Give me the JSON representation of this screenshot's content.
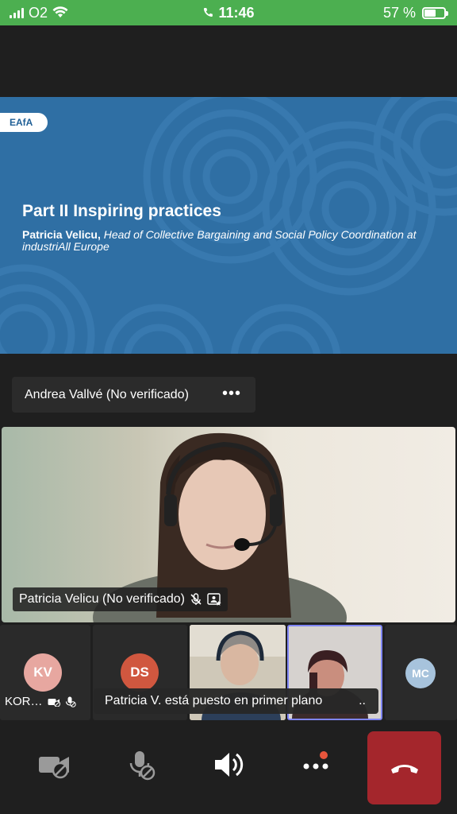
{
  "status_bar": {
    "carrier": "O2",
    "time": "11:46",
    "battery_percent": "57 %",
    "battery_level": 0.57
  },
  "slide": {
    "badge": "EAfA",
    "title": "Part II Inspiring practices",
    "presenter_name": "Patricia Velicu,",
    "presenter_role": " Head of Collective Bargaining and Social Policy Coordination at industriAll Europe"
  },
  "presenter_bar": {
    "name": "Andrea Vallvé (No verificado)",
    "more": "•••"
  },
  "main_video": {
    "label": "Patricia Velicu (No verificado)"
  },
  "tiles": [
    {
      "initials": "KV",
      "name": "KOR…",
      "color": "#e7a7a0"
    },
    {
      "initials": "DS",
      "color": "#d0573f"
    },
    {
      "initials": "MC",
      "color": "#a7c3dc"
    }
  ],
  "toast": {
    "text": "Patricia V. está puesto en primer plano",
    "more": ".."
  },
  "toolbar": {
    "camera_icon": "camera-off-icon",
    "mic_icon": "mic-off-icon",
    "speaker_icon": "speaker-icon",
    "more_icon": "more-icon",
    "end_call_icon": "end-call-icon",
    "end_call_color": "#a4262c"
  }
}
